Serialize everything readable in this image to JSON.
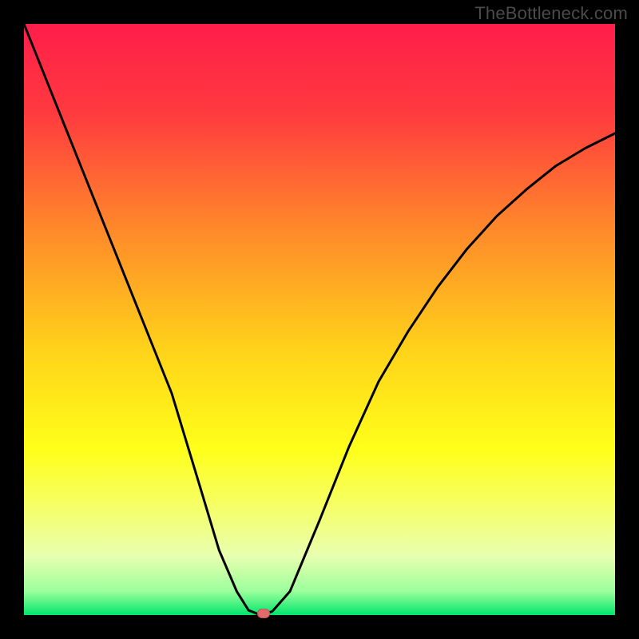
{
  "watermark": "TheBottleneck.com",
  "chart_data": {
    "type": "line",
    "title": "",
    "xlabel": "",
    "ylabel": "",
    "xlim": [
      0,
      1
    ],
    "ylim": [
      0,
      1
    ],
    "series": [
      {
        "name": "bottleneck-curve",
        "x": [
          0.0,
          0.05,
          0.1,
          0.15,
          0.2,
          0.25,
          0.3,
          0.33,
          0.36,
          0.38,
          0.4,
          0.42,
          0.45,
          0.5,
          0.55,
          0.6,
          0.65,
          0.7,
          0.75,
          0.8,
          0.85,
          0.9,
          0.95,
          1.0
        ],
        "y": [
          1.0,
          0.875,
          0.75,
          0.625,
          0.5,
          0.375,
          0.21,
          0.11,
          0.04,
          0.008,
          0.0,
          0.006,
          0.04,
          0.16,
          0.285,
          0.395,
          0.48,
          0.555,
          0.62,
          0.675,
          0.72,
          0.76,
          0.79,
          0.815
        ]
      }
    ],
    "gradient_stops": [
      {
        "offset": 0.0,
        "color": "#ff1e4a"
      },
      {
        "offset": 0.15,
        "color": "#ff3a3f"
      },
      {
        "offset": 0.35,
        "color": "#ff8a2a"
      },
      {
        "offset": 0.55,
        "color": "#ffd21a"
      },
      {
        "offset": 0.72,
        "color": "#ffff1a"
      },
      {
        "offset": 0.82,
        "color": "#f5ff6a"
      },
      {
        "offset": 0.9,
        "color": "#e8ffb0"
      },
      {
        "offset": 0.96,
        "color": "#9bff9b"
      },
      {
        "offset": 1.0,
        "color": "#00e66b"
      }
    ],
    "marker": {
      "x": 0.405,
      "y": 0.003,
      "color": "#e26a6a"
    }
  }
}
